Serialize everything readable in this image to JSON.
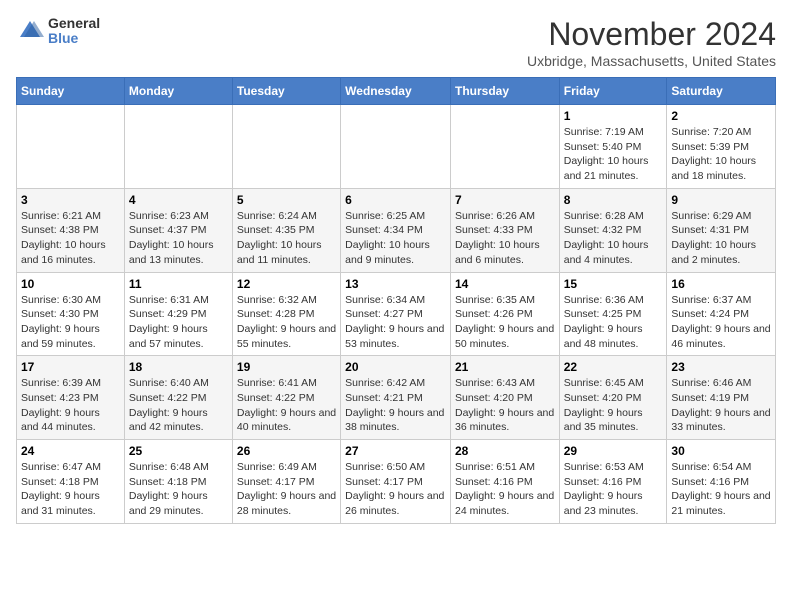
{
  "logo": {
    "general": "General",
    "blue": "Blue"
  },
  "title": "November 2024",
  "location": "Uxbridge, Massachusetts, United States",
  "days_of_week": [
    "Sunday",
    "Monday",
    "Tuesday",
    "Wednesday",
    "Thursday",
    "Friday",
    "Saturday"
  ],
  "weeks": [
    [
      {
        "day": "",
        "info": ""
      },
      {
        "day": "",
        "info": ""
      },
      {
        "day": "",
        "info": ""
      },
      {
        "day": "",
        "info": ""
      },
      {
        "day": "",
        "info": ""
      },
      {
        "day": "1",
        "info": "Sunrise: 7:19 AM\nSunset: 5:40 PM\nDaylight: 10 hours and 21 minutes."
      },
      {
        "day": "2",
        "info": "Sunrise: 7:20 AM\nSunset: 5:39 PM\nDaylight: 10 hours and 18 minutes."
      }
    ],
    [
      {
        "day": "3",
        "info": "Sunrise: 6:21 AM\nSunset: 4:38 PM\nDaylight: 10 hours and 16 minutes."
      },
      {
        "day": "4",
        "info": "Sunrise: 6:23 AM\nSunset: 4:37 PM\nDaylight: 10 hours and 13 minutes."
      },
      {
        "day": "5",
        "info": "Sunrise: 6:24 AM\nSunset: 4:35 PM\nDaylight: 10 hours and 11 minutes."
      },
      {
        "day": "6",
        "info": "Sunrise: 6:25 AM\nSunset: 4:34 PM\nDaylight: 10 hours and 9 minutes."
      },
      {
        "day": "7",
        "info": "Sunrise: 6:26 AM\nSunset: 4:33 PM\nDaylight: 10 hours and 6 minutes."
      },
      {
        "day": "8",
        "info": "Sunrise: 6:28 AM\nSunset: 4:32 PM\nDaylight: 10 hours and 4 minutes."
      },
      {
        "day": "9",
        "info": "Sunrise: 6:29 AM\nSunset: 4:31 PM\nDaylight: 10 hours and 2 minutes."
      }
    ],
    [
      {
        "day": "10",
        "info": "Sunrise: 6:30 AM\nSunset: 4:30 PM\nDaylight: 9 hours and 59 minutes."
      },
      {
        "day": "11",
        "info": "Sunrise: 6:31 AM\nSunset: 4:29 PM\nDaylight: 9 hours and 57 minutes."
      },
      {
        "day": "12",
        "info": "Sunrise: 6:32 AM\nSunset: 4:28 PM\nDaylight: 9 hours and 55 minutes."
      },
      {
        "day": "13",
        "info": "Sunrise: 6:34 AM\nSunset: 4:27 PM\nDaylight: 9 hours and 53 minutes."
      },
      {
        "day": "14",
        "info": "Sunrise: 6:35 AM\nSunset: 4:26 PM\nDaylight: 9 hours and 50 minutes."
      },
      {
        "day": "15",
        "info": "Sunrise: 6:36 AM\nSunset: 4:25 PM\nDaylight: 9 hours and 48 minutes."
      },
      {
        "day": "16",
        "info": "Sunrise: 6:37 AM\nSunset: 4:24 PM\nDaylight: 9 hours and 46 minutes."
      }
    ],
    [
      {
        "day": "17",
        "info": "Sunrise: 6:39 AM\nSunset: 4:23 PM\nDaylight: 9 hours and 44 minutes."
      },
      {
        "day": "18",
        "info": "Sunrise: 6:40 AM\nSunset: 4:22 PM\nDaylight: 9 hours and 42 minutes."
      },
      {
        "day": "19",
        "info": "Sunrise: 6:41 AM\nSunset: 4:22 PM\nDaylight: 9 hours and 40 minutes."
      },
      {
        "day": "20",
        "info": "Sunrise: 6:42 AM\nSunset: 4:21 PM\nDaylight: 9 hours and 38 minutes."
      },
      {
        "day": "21",
        "info": "Sunrise: 6:43 AM\nSunset: 4:20 PM\nDaylight: 9 hours and 36 minutes."
      },
      {
        "day": "22",
        "info": "Sunrise: 6:45 AM\nSunset: 4:20 PM\nDaylight: 9 hours and 35 minutes."
      },
      {
        "day": "23",
        "info": "Sunrise: 6:46 AM\nSunset: 4:19 PM\nDaylight: 9 hours and 33 minutes."
      }
    ],
    [
      {
        "day": "24",
        "info": "Sunrise: 6:47 AM\nSunset: 4:18 PM\nDaylight: 9 hours and 31 minutes."
      },
      {
        "day": "25",
        "info": "Sunrise: 6:48 AM\nSunset: 4:18 PM\nDaylight: 9 hours and 29 minutes."
      },
      {
        "day": "26",
        "info": "Sunrise: 6:49 AM\nSunset: 4:17 PM\nDaylight: 9 hours and 28 minutes."
      },
      {
        "day": "27",
        "info": "Sunrise: 6:50 AM\nSunset: 4:17 PM\nDaylight: 9 hours and 26 minutes."
      },
      {
        "day": "28",
        "info": "Sunrise: 6:51 AM\nSunset: 4:16 PM\nDaylight: 9 hours and 24 minutes."
      },
      {
        "day": "29",
        "info": "Sunrise: 6:53 AM\nSunset: 4:16 PM\nDaylight: 9 hours and 23 minutes."
      },
      {
        "day": "30",
        "info": "Sunrise: 6:54 AM\nSunset: 4:16 PM\nDaylight: 9 hours and 21 minutes."
      }
    ]
  ]
}
